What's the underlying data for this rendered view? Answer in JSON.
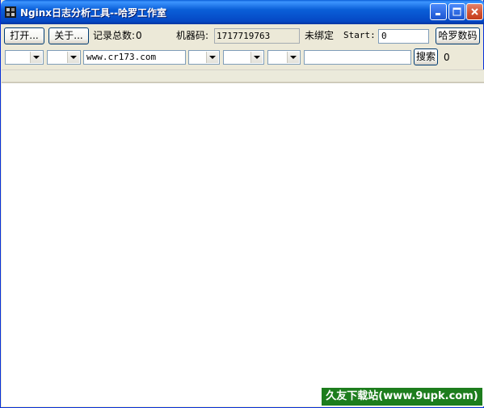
{
  "window": {
    "title": "Nginx日志分析工具--哈罗工作室"
  },
  "toolbar": {
    "open_label": "打开...",
    "about_label": "关于...",
    "record_total_label": "记录总数:",
    "record_total_value": "0",
    "machine_code_label": "机器码:",
    "machine_code_value": "1717719763",
    "binding_status": "未绑定",
    "start_label": "Start:",
    "start_value": "0",
    "haluo_code_label": "哈罗数码"
  },
  "filter": {
    "domain_value": "www.cr173.com",
    "search_value": "",
    "search_label": "搜索",
    "result_count": "0"
  },
  "watermark": {
    "text": "久友下载站(www.9upk.com)"
  },
  "colors": {
    "titlebar": "#0a5fd8",
    "window_bg": "#ece9d8",
    "list_bg": "#ffffff",
    "watermark_bg": "#1d7d1d"
  }
}
